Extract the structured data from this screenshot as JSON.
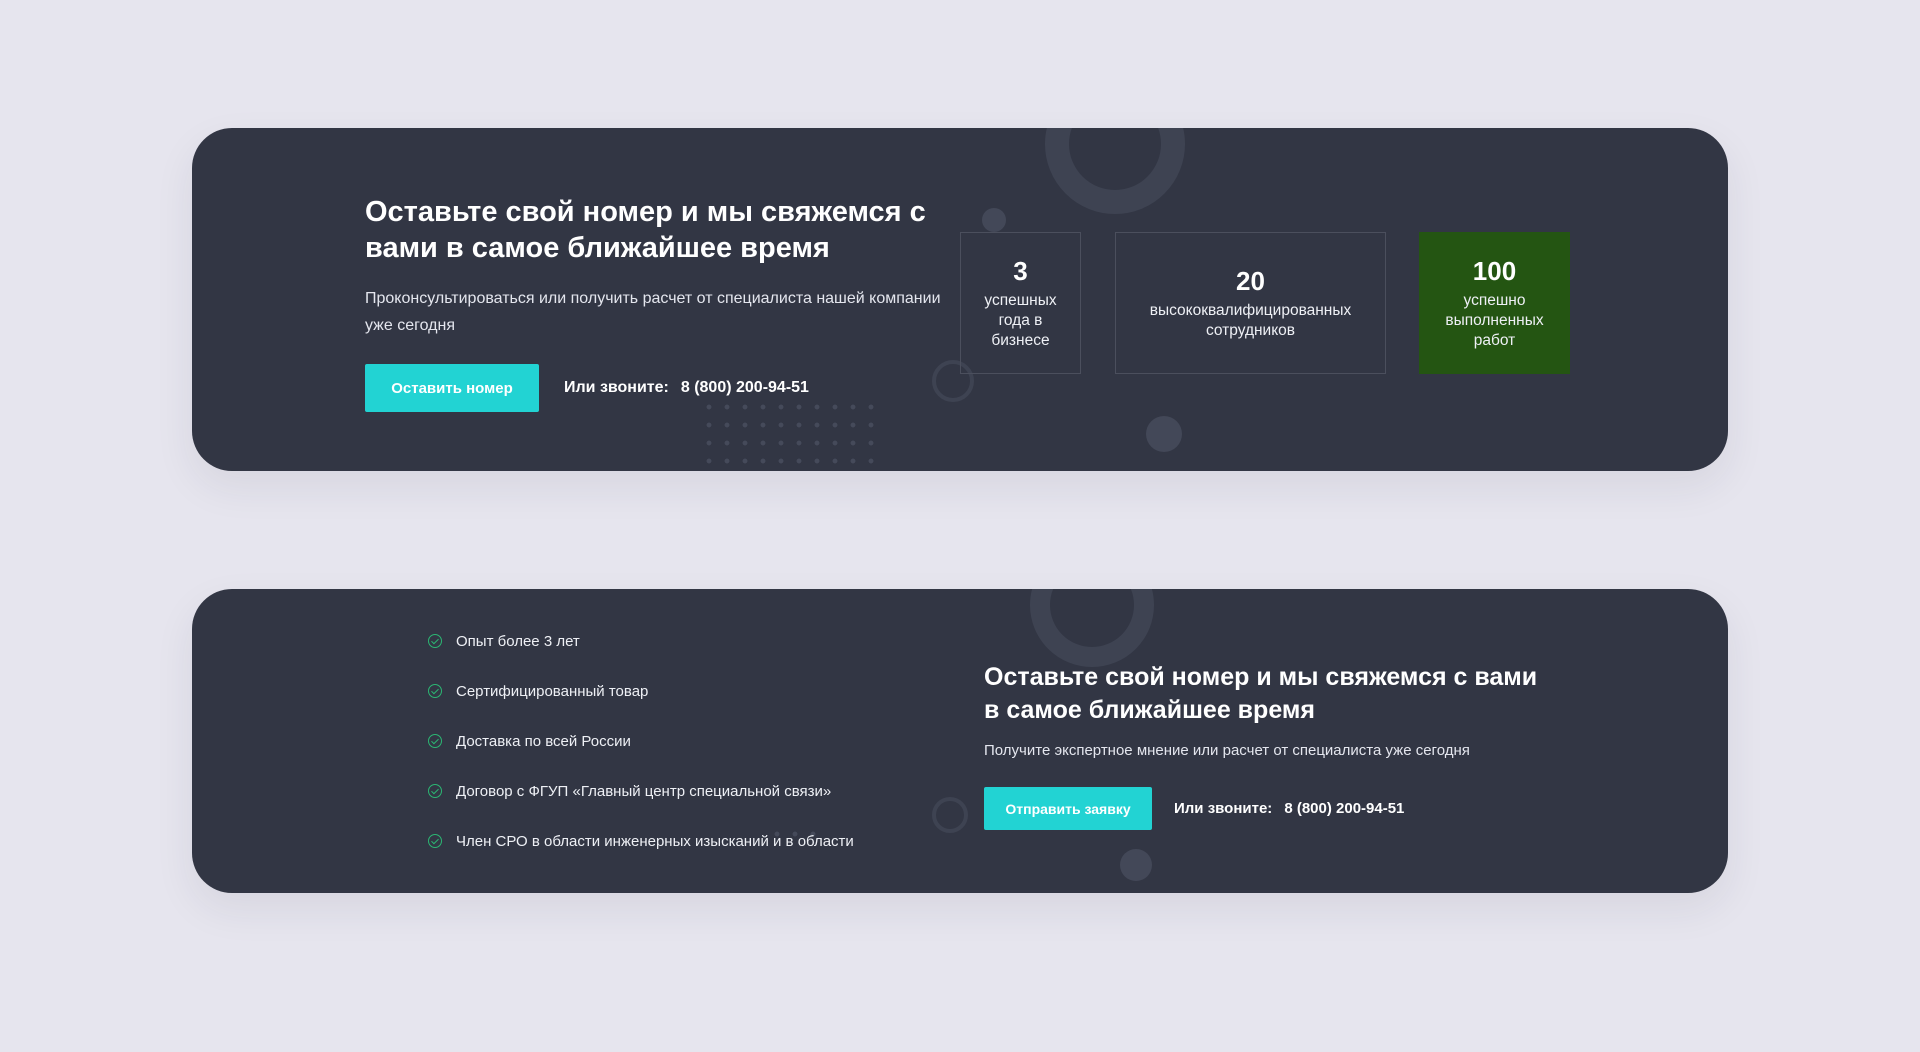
{
  "banner_top": {
    "title": "Оставьте свой номер и мы свяжемся с вами в самое ближайшее время",
    "subtitle": "Проконсультироваться или получить расчет от специалиста нашей компании уже сегодня",
    "button_label": "Оставить номер",
    "call_label": "Или звоните:",
    "phone": "8 (800) 200-94-51",
    "stats": [
      {
        "value": "3",
        "label": "успешных года в бизнесе"
      },
      {
        "value": "20",
        "label": "высококвалифицированных сотрудников"
      },
      {
        "value": "100",
        "label": "успешно выполненных работ"
      }
    ]
  },
  "banner_bottom": {
    "features": [
      "Опыт более 3 лет",
      "Сертифицированный товар",
      "Доставка по всей России",
      "Договор с ФГУП «Главный центр специальной связи»",
      "Член СРО в области инженерных изысканий и в области"
    ],
    "title": "Оставьте свой номер и мы свяжемся с вами в самое ближайшее время",
    "subtitle": "Получите экспертное мнение или расчет от специалиста уже сегодня",
    "button_label": "Отправить заявку",
    "call_label": "Или звоните:",
    "phone": "8 (800) 200-94-51"
  },
  "colors": {
    "page_bg": "#e6e5ee",
    "banner_bg": "#323644",
    "accent_button": "#22d3d3",
    "highlight_stat": "#245512",
    "check_icon": "#2bb673"
  },
  "icons": [
    "check-circle-icon"
  ]
}
